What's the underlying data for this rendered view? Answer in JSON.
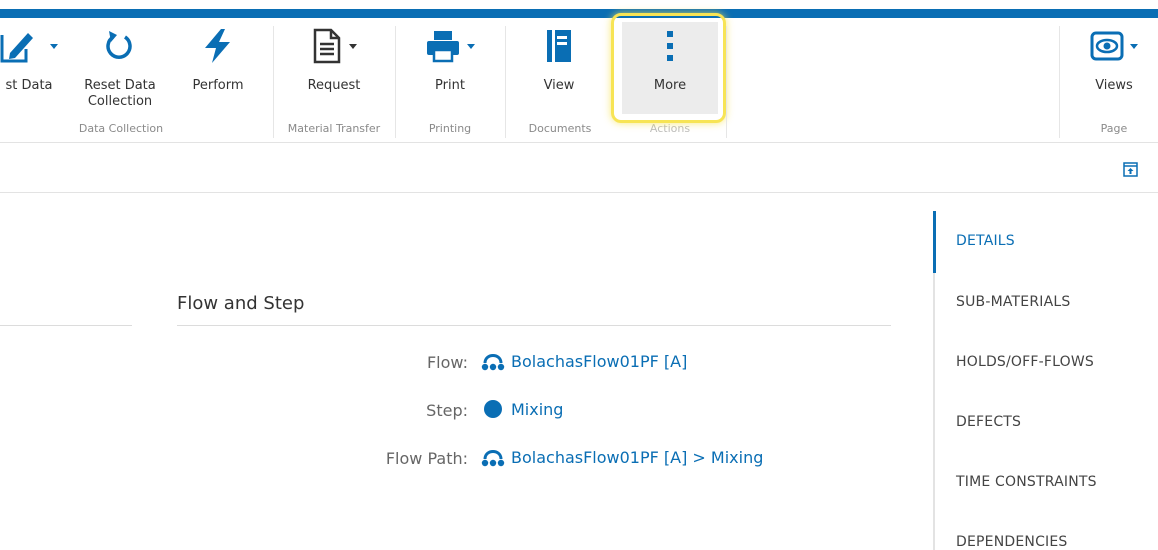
{
  "ribbon": {
    "buttons": {
      "post_data": "st Data",
      "reset_data_collection_line1": "Reset Data",
      "reset_data_collection_line2": "Collection",
      "perform": "Perform",
      "request": "Request",
      "print": "Print",
      "view": "View",
      "more": "More",
      "views": "Views"
    },
    "groups": {
      "data_collection": "Data Collection",
      "material_transfer": "Material Transfer",
      "printing": "Printing",
      "documents": "Documents",
      "actions": "Actions",
      "page": "Page"
    },
    "icons": {
      "post_data": "edit-icon",
      "reset": "reset-icon",
      "perform": "lightning-icon",
      "request": "document-icon",
      "print": "printer-icon",
      "view": "book-icon",
      "more": "more-vertical-icon",
      "views": "eye-icon"
    }
  },
  "details": {
    "section_title": "Flow and Step",
    "fields": [
      {
        "label": "Flow:",
        "value": "BolachasFlow01PF [A]",
        "icon": "flow-icon"
      },
      {
        "label": "Step:",
        "value": "Mixing",
        "icon": "step-circle-icon"
      },
      {
        "label": "Flow Path:",
        "value": "BolachasFlow01PF [A] > Mixing",
        "icon": "flow-icon"
      }
    ]
  },
  "sidenav": {
    "items": [
      {
        "label": "DETAILS",
        "active": true
      },
      {
        "label": "SUB-MATERIALS",
        "active": false
      },
      {
        "label": "HOLDS/OFF-FLOWS",
        "active": false
      },
      {
        "label": "DEFECTS",
        "active": false
      },
      {
        "label": "TIME CONSTRAINTS",
        "active": false
      },
      {
        "label": "DEPENDENCIES",
        "active": false
      }
    ]
  },
  "colors": {
    "accent": "#0a6eb4",
    "highlight": "#f7e455",
    "more_bg": "#ececec"
  }
}
